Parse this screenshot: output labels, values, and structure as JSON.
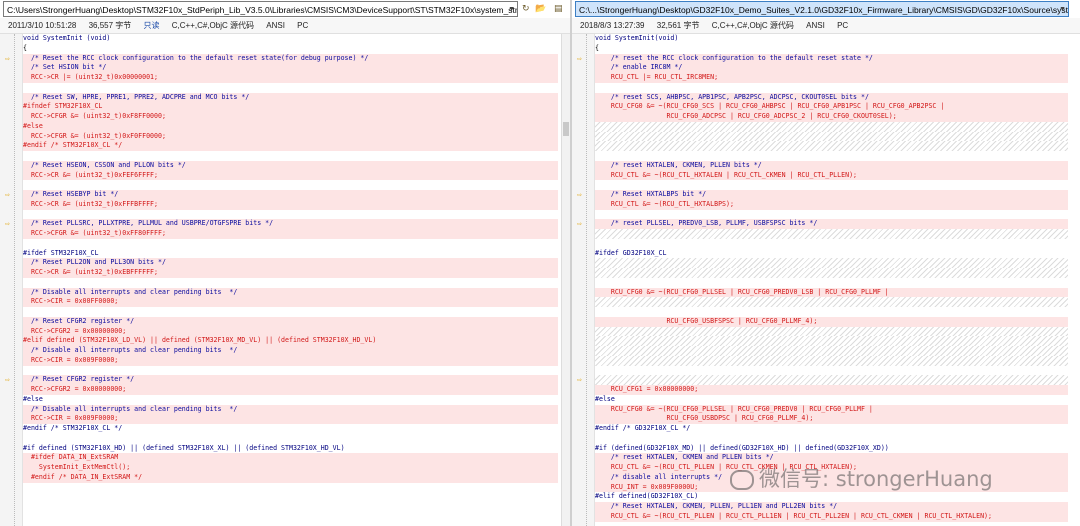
{
  "left": {
    "path": "C:\\Users\\StrongerHuang\\Desktop\\STM32F10x_StdPeriph_Lib_V3.5.0\\Libraries\\CMSIS\\CM3\\DeviceSupport\\ST\\STM32F10x\\system_stm32f10x.c",
    "datetime": "2011/3/10 10:51:28",
    "size": "36,557 字节",
    "readonly": "只读",
    "lang": "C,C++,C#,ObjC 源代码",
    "encoding": "ANSI",
    "eol": "PC",
    "lines": [
      {
        "t": "void SystemInit (void)",
        "c": "kw",
        "b": ""
      },
      {
        "t": "{",
        "c": "",
        "b": ""
      },
      {
        "t": "  /* Reset the RCC clock configuration to the default reset state(for debug purpose) */",
        "c": "cm",
        "b": "diff",
        "a": true
      },
      {
        "t": "  /* Set HSION bit */",
        "c": "cm",
        "b": "diff"
      },
      {
        "t": "  RCC->CR |= (uint32_t)0x00000001;",
        "c": "rd",
        "b": "diff"
      },
      {
        "t": "",
        "c": "",
        "b": ""
      },
      {
        "t": "  /* Reset SW, HPRE, PPRE1, PPRE2, ADCPRE and MCO bits */",
        "c": "cm",
        "b": "diff"
      },
      {
        "t": "#ifndef STM32F10X_CL",
        "c": "rd",
        "b": "diff"
      },
      {
        "t": "  RCC->CFGR &= (uint32_t)0xF8FF0000;",
        "c": "rd",
        "b": "diff"
      },
      {
        "t": "#else",
        "c": "rd",
        "b": "diff"
      },
      {
        "t": "  RCC->CFGR &= (uint32_t)0xF0FF0000;",
        "c": "rd",
        "b": "diff"
      },
      {
        "t": "#endif /* STM32F10X_CL */",
        "c": "rd",
        "b": "diff"
      },
      {
        "t": "",
        "c": "",
        "b": ""
      },
      {
        "t": "  /* Reset HSEON, CSSON and PLLON bits */",
        "c": "cm",
        "b": "diff"
      },
      {
        "t": "  RCC->CR &= (uint32_t)0xFEF6FFFF;",
        "c": "rd",
        "b": "diff"
      },
      {
        "t": "",
        "c": "",
        "b": ""
      },
      {
        "t": "  /* Reset HSEBYP bit */",
        "c": "cm",
        "b": "diff",
        "a": true
      },
      {
        "t": "  RCC->CR &= (uint32_t)0xFFFBFFFF;",
        "c": "rd",
        "b": "diff"
      },
      {
        "t": "",
        "c": "",
        "b": ""
      },
      {
        "t": "  /* Reset PLLSRC, PLLXTPRE, PLLMUL and USBPRE/OTGFSPRE bits */",
        "c": "cm",
        "b": "diff",
        "a": true
      },
      {
        "t": "  RCC->CFGR &= (uint32_t)0xFF80FFFF;",
        "c": "rd",
        "b": "diff"
      },
      {
        "t": "",
        "c": "",
        "b": ""
      },
      {
        "t": "#ifdef STM32F10X_CL",
        "c": "kw",
        "b": ""
      },
      {
        "t": "  /* Reset PLL2ON and PLL3ON bits */",
        "c": "cm",
        "b": "diff"
      },
      {
        "t": "  RCC->CR &= (uint32_t)0xEBFFFFFF;",
        "c": "rd",
        "b": "diff"
      },
      {
        "t": "",
        "c": "",
        "b": ""
      },
      {
        "t": "  /* Disable all interrupts and clear pending bits  */",
        "c": "cm",
        "b": "diff"
      },
      {
        "t": "  RCC->CIR = 0x00FF0000;",
        "c": "rd",
        "b": "diff"
      },
      {
        "t": "",
        "c": "",
        "b": ""
      },
      {
        "t": "  /* Reset CFGR2 register */",
        "c": "cm",
        "b": "diff"
      },
      {
        "t": "  RCC->CFGR2 = 0x00000000;",
        "c": "rd",
        "b": "diff"
      },
      {
        "t": "#elif defined (STM32F10X_LD_VL) || defined (STM32F10X_MD_VL) || (defined STM32F10X_HD_VL)",
        "c": "rd",
        "b": "diff"
      },
      {
        "t": "  /* Disable all interrupts and clear pending bits  */",
        "c": "cm",
        "b": "diff"
      },
      {
        "t": "  RCC->CIR = 0x009F0000;",
        "c": "rd",
        "b": "diff"
      },
      {
        "t": "",
        "c": "",
        "b": ""
      },
      {
        "t": "  /* Reset CFGR2 register */",
        "c": "cm",
        "b": "diff",
        "a": true
      },
      {
        "t": "  RCC->CFGR2 = 0x00000000;",
        "c": "rd",
        "b": "diff"
      },
      {
        "t": "#else",
        "c": "kw",
        "b": ""
      },
      {
        "t": "  /* Disable all interrupts and clear pending bits  */",
        "c": "cm",
        "b": "diff"
      },
      {
        "t": "  RCC->CIR = 0x009F0000;",
        "c": "rd",
        "b": "diff"
      },
      {
        "t": "#endif /* STM32F10X_CL */",
        "c": "kw",
        "b": ""
      },
      {
        "t": "",
        "c": "",
        "b": ""
      },
      {
        "t": "#if defined (STM32F10X_HD) || (defined STM32F10X_XL) || (defined STM32F10X_HD_VL)",
        "c": "kw",
        "b": ""
      },
      {
        "t": "  #ifdef DATA_IN_ExtSRAM",
        "c": "rd",
        "b": "diff"
      },
      {
        "t": "    SystemInit_ExtMemCtl();",
        "c": "rd",
        "b": "diff"
      },
      {
        "t": "  #endif /* DATA_IN_ExtSRAM */",
        "c": "rd",
        "b": "diff"
      },
      {
        "t": "",
        "c": "",
        "b": ""
      },
      {
        "t": "",
        "c": "",
        "b": ""
      },
      {
        "t": "",
        "c": "",
        "b": ""
      }
    ]
  },
  "right": {
    "path": "C:\\...\\StrongerHuang\\Desktop\\GD32F10x_Demo_Suites_V2.1.0\\GD32F10x_Firmware_Library\\CMSIS\\GD\\GD32F10x\\Source\\system_gd32f10x.c",
    "datetime": "2018/8/3 13:27:39",
    "size": "32,561 字节",
    "lang": "C,C++,C#,ObjC 源代码",
    "encoding": "ANSI",
    "eol": "PC",
    "lines": [
      {
        "t": "void SystemInit(void)",
        "c": "kw",
        "b": ""
      },
      {
        "t": "{",
        "c": "",
        "b": ""
      },
      {
        "t": "    /* reset the RCC clock configuration to the default reset state */",
        "c": "cm",
        "b": "diff",
        "a": true
      },
      {
        "t": "    /* enable IRC8M */",
        "c": "cm",
        "b": "diff"
      },
      {
        "t": "    RCU_CTL |= RCU_CTL_IRC8MEN;",
        "c": "rd",
        "b": "diff"
      },
      {
        "t": "",
        "c": "",
        "b": ""
      },
      {
        "t": "    /* reset SCS, AHBPSC, APB1PSC, APB2PSC, ADCPSC, CKOUT0SEL bits */",
        "c": "cm",
        "b": "diff"
      },
      {
        "t": "    RCU_CFG0 &= ~(RCU_CFG0_SCS | RCU_CFG0_AHBPSC | RCU_CFG0_APB1PSC | RCU_CFG0_APB2PSC |",
        "c": "rd",
        "b": "diff"
      },
      {
        "t": "                  RCU_CFG0_ADCPSC | RCU_CFG0_ADCPSC_2 | RCU_CFG0_CKOUT0SEL);",
        "c": "rd",
        "b": "diff"
      },
      {
        "t": "",
        "c": "",
        "b": "gap"
      },
      {
        "t": "",
        "c": "",
        "b": "gap"
      },
      {
        "t": "",
        "c": "",
        "b": "gap"
      },
      {
        "t": "",
        "c": "",
        "b": ""
      },
      {
        "t": "    /* reset HXTALEN, CKMEN, PLLEN bits */",
        "c": "cm",
        "b": "diff"
      },
      {
        "t": "    RCU_CTL &= ~(RCU_CTL_HXTALEN | RCU_CTL_CKMEN | RCU_CTL_PLLEN);",
        "c": "rd",
        "b": "diff"
      },
      {
        "t": "",
        "c": "",
        "b": ""
      },
      {
        "t": "    /* Reset HXTALBPS bit */",
        "c": "cm",
        "b": "diff",
        "a": true
      },
      {
        "t": "    RCU_CTL &= ~(RCU_CTL_HXTALBPS);",
        "c": "rd",
        "b": "diff"
      },
      {
        "t": "",
        "c": "",
        "b": ""
      },
      {
        "t": "    /* reset PLLSEL, PREDV0_LSB, PLLMF, USBFSPSC bits */",
        "c": "cm",
        "b": "diff",
        "a": true
      },
      {
        "t": "",
        "c": "",
        "b": "gap"
      },
      {
        "t": "",
        "c": "",
        "b": ""
      },
      {
        "t": "#ifdef GD32F10X_CL",
        "c": "kw",
        "b": ""
      },
      {
        "t": "",
        "c": "",
        "b": "gap"
      },
      {
        "t": "",
        "c": "",
        "b": "gap"
      },
      {
        "t": "",
        "c": "",
        "b": ""
      },
      {
        "t": "    RCU_CFG0 &= ~(RCU_CFG0_PLLSEL | RCU_CFG0_PREDV0_LSB | RCU_CFG0_PLLMF |",
        "c": "rd",
        "b": "diff"
      },
      {
        "t": "",
        "c": "",
        "b": "gap"
      },
      {
        "t": "",
        "c": "",
        "b": ""
      },
      {
        "t": "                  RCU_CFG0_USBFSPSC | RCU_CFG0_PLLMF_4);",
        "c": "rd",
        "b": "diff"
      },
      {
        "t": "",
        "c": "",
        "b": "gap"
      },
      {
        "t": "",
        "c": "",
        "b": "gap"
      },
      {
        "t": "",
        "c": "",
        "b": "gap"
      },
      {
        "t": "",
        "c": "",
        "b": "gap"
      },
      {
        "t": "",
        "c": "",
        "b": ""
      },
      {
        "t": "",
        "c": "",
        "b": "gap",
        "a": true
      },
      {
        "t": "    RCU_CFG1 = 0x00000000;",
        "c": "rd",
        "b": "diff"
      },
      {
        "t": "#else",
        "c": "kw",
        "b": ""
      },
      {
        "t": "    RCU_CFG0 &= ~(RCU_CFG0_PLLSEL | RCU_CFG0_PREDV0 | RCU_CFG0_PLLMF |",
        "c": "rd",
        "b": "diff"
      },
      {
        "t": "                  RCU_CFG0_USBDPSC | RCU_CFG0_PLLMF_4);",
        "c": "rd",
        "b": "diff"
      },
      {
        "t": "#endif /* GD32F10X_CL */",
        "c": "kw",
        "b": ""
      },
      {
        "t": "",
        "c": "",
        "b": ""
      },
      {
        "t": "#if (defined(GD32F10X_MD) || defined(GD32F10X_HD) || defined(GD32F10X_XD))",
        "c": "kw",
        "b": ""
      },
      {
        "t": "    /* reset HXTALEN, CKMEN and PLLEN bits */",
        "c": "cm",
        "b": "diff"
      },
      {
        "t": "    RCU_CTL &= ~(RCU_CTL_PLLEN | RCU_CTL_CKMEN | RCU_CTL_HXTALEN);",
        "c": "rd",
        "b": "diff"
      },
      {
        "t": "    /* disable all interrupts */",
        "c": "cm",
        "b": "diff"
      },
      {
        "t": "    RCU_INT = 0x009F0000U;",
        "c": "rd",
        "b": "diff"
      },
      {
        "t": "#elif defined(GD32F10X_CL)",
        "c": "kw",
        "b": ""
      },
      {
        "t": "    /* Reset HXTALEN, CKMEN, PLLEN, PLL1EN and PLL2EN bits */",
        "c": "cm",
        "b": "diff"
      },
      {
        "t": "    RCU_CTL &= ~(RCU_CTL_PLLEN | RCU_CTL_PLL1EN | RCU_CTL_PLL2EN | RCU_CTL_CKMEN | RCU_CTL_HXTALEN);",
        "c": "rd",
        "b": "diff"
      }
    ]
  },
  "watermark": {
    "text": "微信号: strongerHuang"
  }
}
